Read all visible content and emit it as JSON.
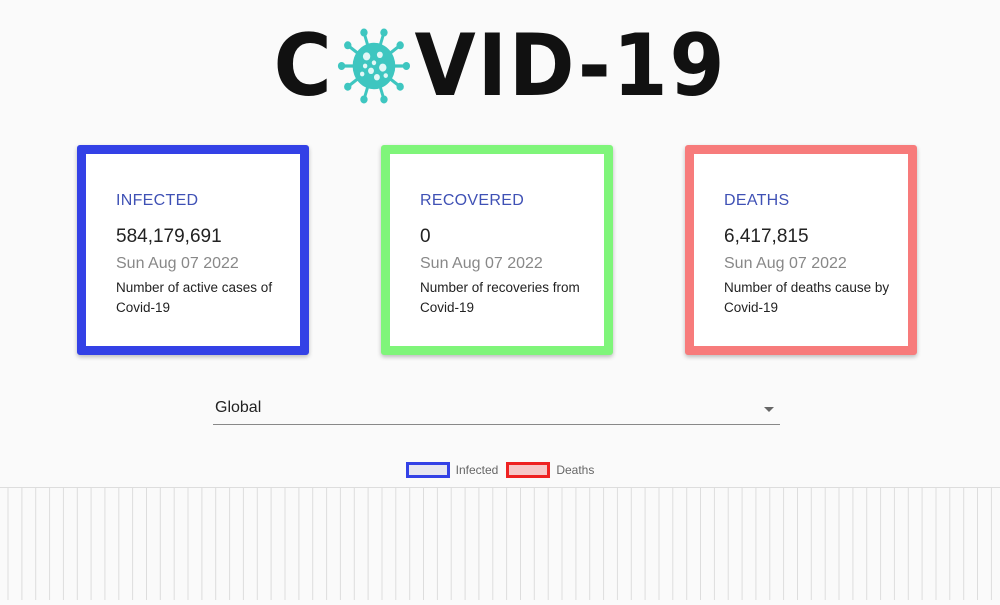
{
  "header": {
    "logo_left": "C",
    "logo_right": "VID-19",
    "virus_icon": "coronavirus-icon",
    "virus_color": "#3ec6c0"
  },
  "cards": [
    {
      "title": "INFECTED",
      "count": "584,179,691",
      "date": "Sun Aug 07 2022",
      "description": "Number of active cases of Covid-19",
      "border_color": "#3341e6"
    },
    {
      "title": "RECOVERED",
      "count": "0",
      "date": "Sun Aug 07 2022",
      "description": "Number of recoveries from Covid-19",
      "border_color": "#7ff57a"
    },
    {
      "title": "DEATHS",
      "count": "6,417,815",
      "date": "Sun Aug 07 2022",
      "description": "Number of deaths cause by Covid-19",
      "border_color": "#f77b7b"
    }
  ],
  "country_select": {
    "value": "Global",
    "icon": "chevron-down-icon"
  },
  "chart": {
    "legend": [
      {
        "label": "Infected",
        "color": "#3341e6",
        "fill": "#e6e6f0"
      },
      {
        "label": "Deaths",
        "color": "#ee2222",
        "fill": "#f6c8c8"
      }
    ],
    "grid_color": "#dddddd"
  },
  "chart_data": {
    "type": "line",
    "series": [
      {
        "name": "Infected",
        "values": []
      },
      {
        "name": "Deaths",
        "values": []
      }
    ],
    "grid": true,
    "legend_position": "top"
  }
}
